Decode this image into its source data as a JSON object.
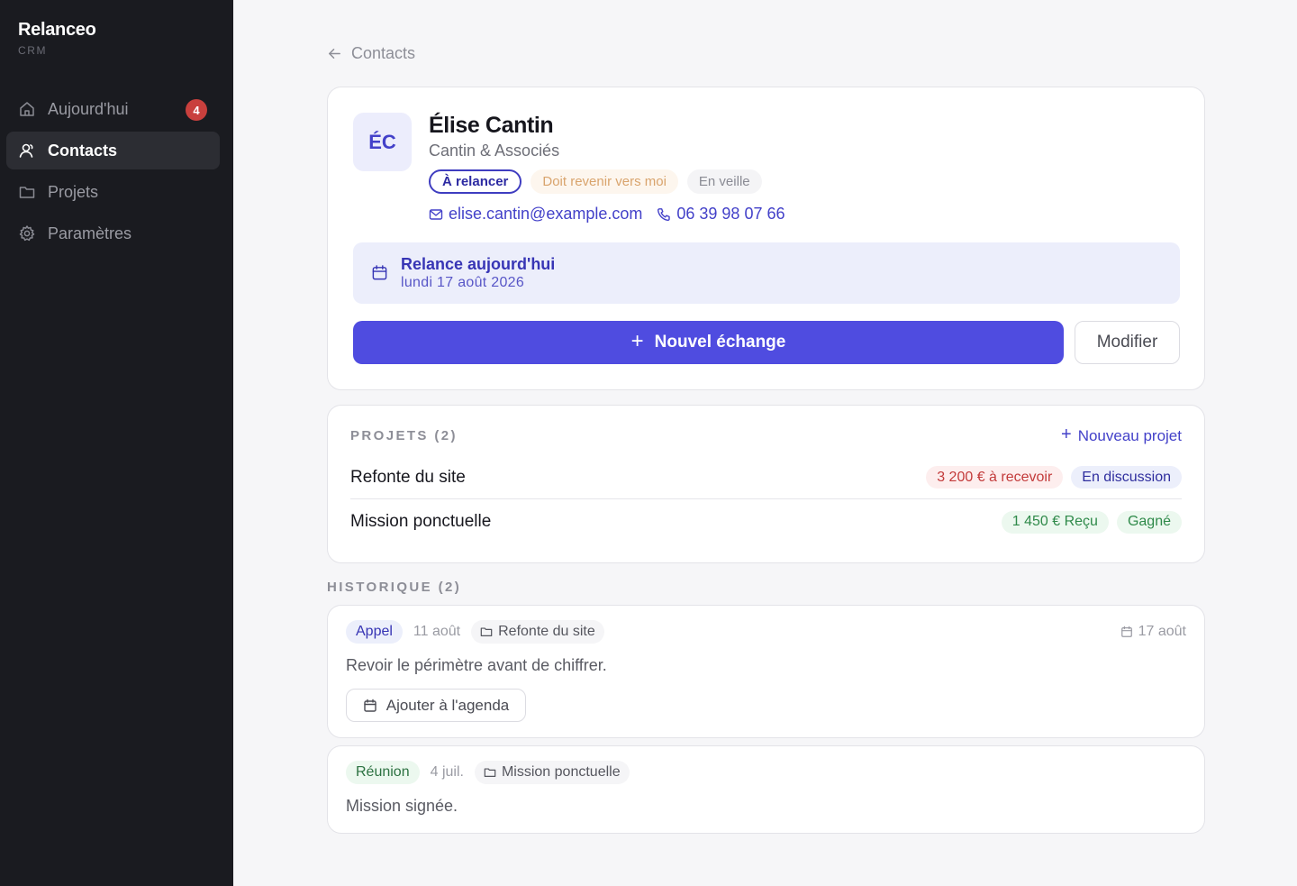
{
  "app": {
    "name": "Relanceo",
    "subtitle": "CRM"
  },
  "sidebar": {
    "items": [
      {
        "label": "Aujourd'hui",
        "icon": "home-icon",
        "badge": "4",
        "active": false
      },
      {
        "label": "Contacts",
        "icon": "contacts-icon",
        "active": true
      },
      {
        "label": "Projets",
        "icon": "folder-icon",
        "active": false
      },
      {
        "label": "Paramètres",
        "icon": "gear-icon",
        "active": false
      }
    ]
  },
  "breadcrumb": {
    "back_label": "Contacts"
  },
  "contact": {
    "initials": "ÉC",
    "name": "Élise Cantin",
    "company": "Cantin & Associés",
    "tags": [
      "À relancer",
      "Doit revenir vers moi",
      "En veille"
    ],
    "email": "elise.cantin@example.com",
    "phone": "06 39 98 07 66"
  },
  "reminder": {
    "title": "Relance aujourd'hui",
    "date": "lundi 17 août 2026"
  },
  "actions": {
    "primary_plus": "+",
    "primary_label": "Nouvel échange",
    "secondary_label": "Modifier"
  },
  "projects": {
    "title": "PROJETS (2)",
    "new_plus": "+",
    "new_label": "Nouveau projet",
    "rows": [
      {
        "name": "Refonte du site",
        "amount": "3 200 € à recevoir",
        "status": "En discussion"
      },
      {
        "name": "Mission ponctuelle",
        "amount": "1 450 € Reçu",
        "status": "Gagné"
      }
    ]
  },
  "history": {
    "title": "HISTORIQUE (2)",
    "entries": [
      {
        "type": "Appel",
        "date": "11 août",
        "project": "Refonte du site",
        "due": "17 août",
        "text": "Revoir le périmètre avant de chiffrer.",
        "action_label": "Ajouter à l'agenda"
      },
      {
        "type": "Réunion",
        "date": "4 juil.",
        "project": "Mission ponctuelle",
        "text": "Mission signée."
      }
    ]
  },
  "colors": {
    "accent": "#4f4ce0",
    "sidebar_bg": "#1a1b20",
    "badge_red": "#c9403d"
  }
}
